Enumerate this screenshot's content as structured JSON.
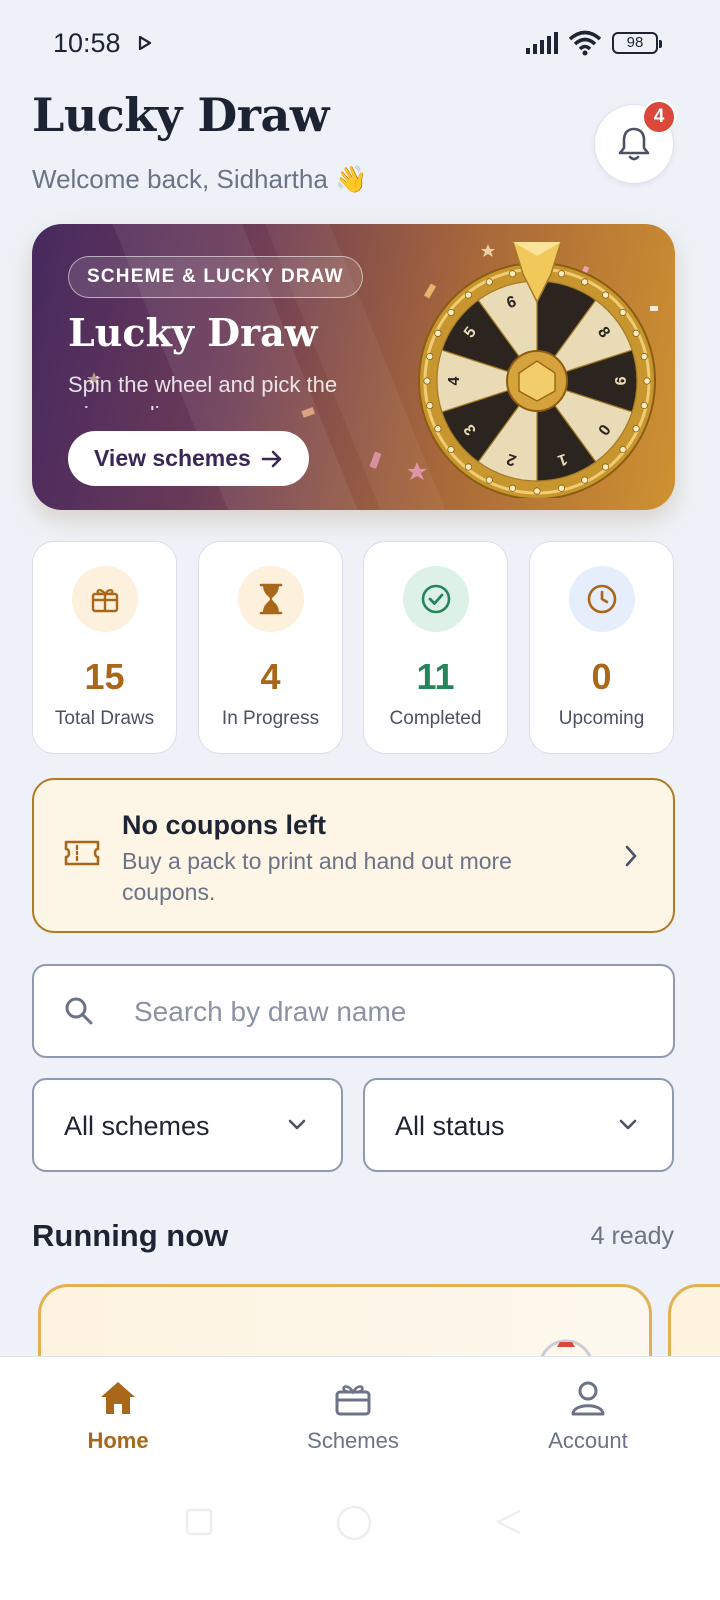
{
  "status_bar": {
    "time": "10:58",
    "battery": "98"
  },
  "header": {
    "title": "Lucky Draw",
    "welcome": "Welcome back, Sidhartha 👋",
    "notification_count": "4"
  },
  "hero": {
    "chip": "SCHEME & LUCKY DRAW",
    "title": "Lucky Draw",
    "subtitle": "Spin the wheel and pick the winners live",
    "button_label": "View schemes",
    "wheel_numbers": [
      "8",
      "9",
      "0",
      "1",
      "2",
      "3",
      "4",
      "5",
      "6"
    ]
  },
  "stats": [
    {
      "value": "15",
      "label": "Total Draws",
      "icon": "gift-icon",
      "color": "#a9671a",
      "bg": "#fdf0dc"
    },
    {
      "value": "4",
      "label": "In Progress",
      "icon": "hourglass-icon",
      "color": "#a9671a",
      "bg": "#fdf0dc"
    },
    {
      "value": "11",
      "label": "Completed",
      "icon": "check-circle-icon",
      "color": "#25855a",
      "bg": "#ddf1e7"
    },
    {
      "value": "0",
      "label": "Upcoming",
      "icon": "clock-icon",
      "color": "#a9671a",
      "bg": "#e6eefb"
    }
  ],
  "coupon_banner": {
    "title": "No coupons left",
    "subtitle": "Buy a pack to print and hand out more coupons."
  },
  "search": {
    "placeholder": "Search by draw name"
  },
  "filters": {
    "scheme": "All schemes",
    "status": "All status"
  },
  "section": {
    "title": "Running now",
    "count": "4 ready"
  },
  "bottom_nav": [
    {
      "label": "Home",
      "active": true
    },
    {
      "label": "Schemes",
      "active": false
    },
    {
      "label": "Account",
      "active": false
    }
  ],
  "colors": {
    "accent": "#a9671a",
    "success": "#25855a",
    "badge": "#d9483b"
  }
}
